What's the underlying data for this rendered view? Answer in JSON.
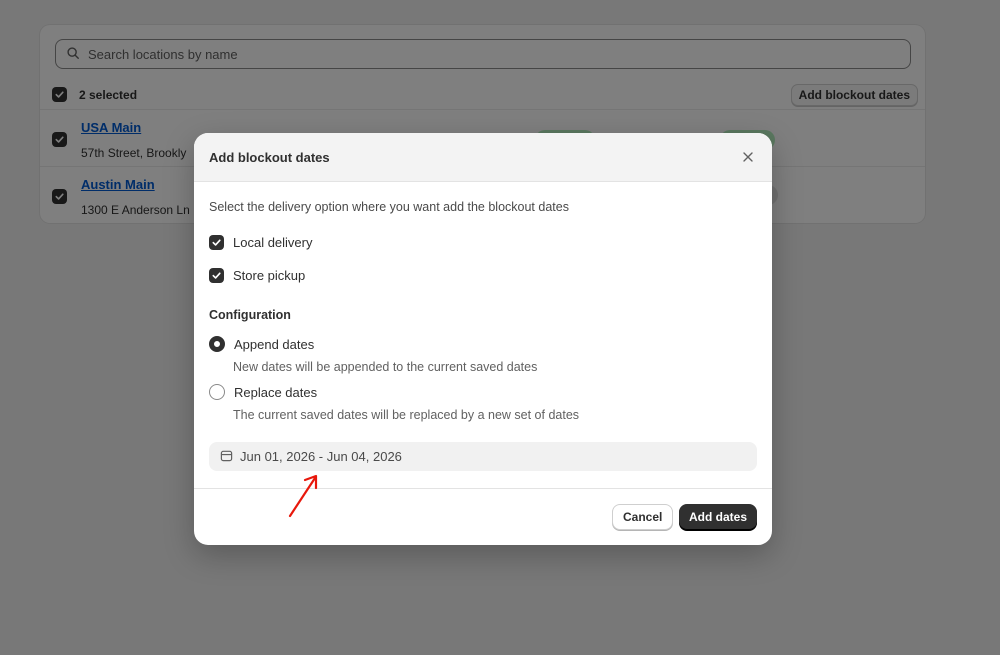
{
  "search": {
    "placeholder": "Search locations by name"
  },
  "selection": {
    "label": "2 selected",
    "action_label": "Add blockout dates"
  },
  "locations": [
    {
      "name": "USA Main",
      "address": "57th Street, Brookly"
    },
    {
      "name": "Austin Main",
      "address": "1300 E Anderson Ln"
    }
  ],
  "modal": {
    "title": "Add blockout dates",
    "description": "Select the delivery option where you want add the blockout dates",
    "options": [
      {
        "label": "Local delivery",
        "checked": true
      },
      {
        "label": "Store pickup",
        "checked": true
      }
    ],
    "configuration": {
      "title": "Configuration",
      "choices": [
        {
          "label": "Append dates",
          "help": "New dates will be appended to the current saved dates",
          "selected": true
        },
        {
          "label": "Replace dates",
          "help": "The current saved dates will be replaced by a new set of dates",
          "selected": false
        }
      ]
    },
    "date_range": "Jun 01, 2026 - Jun 04, 2026",
    "cancel_label": "Cancel",
    "submit_label": "Add dates"
  },
  "icons": {
    "search": "search-icon",
    "close": "close-icon",
    "calendar": "calendar-icon",
    "checkbox": "checkmark-icon",
    "annotation": "red-arrow-icon"
  },
  "colors": {
    "primary": "#303030",
    "link": "#005bd3",
    "overlay": "rgba(0,0,0,0.5)",
    "annotation": "#e8180c",
    "status_pill": "#b4f0bf"
  }
}
